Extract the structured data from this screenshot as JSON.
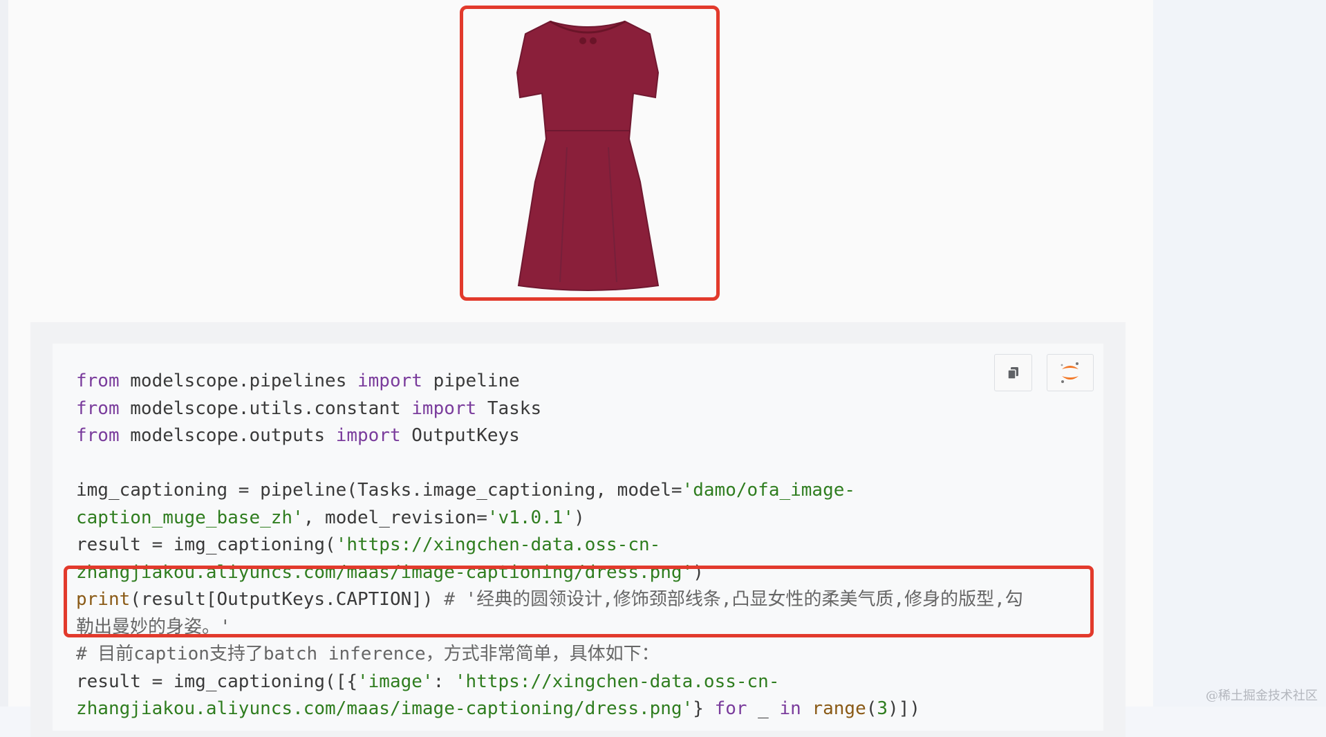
{
  "product_image": {
    "icon": "red-dress-image"
  },
  "toolbar": {
    "copy_icon": "copy-icon",
    "jupyter_icon": "jupyter-icon"
  },
  "code": {
    "lines": [
      [
        {
          "c": "kw",
          "t": "from"
        },
        {
          "c": "",
          "t": " modelscope.pipelines "
        },
        {
          "c": "kw",
          "t": "import"
        },
        {
          "c": "",
          "t": " pipeline"
        }
      ],
      [
        {
          "c": "kw",
          "t": "from"
        },
        {
          "c": "",
          "t": " modelscope.utils.constant "
        },
        {
          "c": "kw",
          "t": "import"
        },
        {
          "c": "",
          "t": " Tasks"
        }
      ],
      [
        {
          "c": "kw",
          "t": "from"
        },
        {
          "c": "",
          "t": " modelscope.outputs "
        },
        {
          "c": "kw",
          "t": "import"
        },
        {
          "c": "",
          "t": " OutputKeys"
        }
      ],
      [],
      [
        {
          "c": "",
          "t": "img_captioning = pipeline(Tasks.image_captioning, model="
        },
        {
          "c": "str",
          "t": "'damo/ofa_image-"
        }
      ],
      [
        {
          "c": "str",
          "t": "caption_muge_base_zh'"
        },
        {
          "c": "",
          "t": ", model_revision="
        },
        {
          "c": "str",
          "t": "'v1.0.1'"
        },
        {
          "c": "",
          "t": ")"
        }
      ],
      [
        {
          "c": "",
          "t": "result = img_captioning("
        },
        {
          "c": "str",
          "t": "'https://xingchen-data.oss-cn-"
        }
      ],
      [
        {
          "c": "str",
          "t": "zhangjiakou.aliyuncs.com/maas/image-captioning/dress.png'"
        },
        {
          "c": "",
          "t": ")"
        }
      ],
      [
        {
          "c": "fn",
          "t": "print"
        },
        {
          "c": "",
          "t": "(result[OutputKeys.CAPTION]) "
        },
        {
          "c": "cm",
          "t": "# '经典的圆领设计,修饰颈部线条,凸显女性的柔美气质,修身的版型,勾"
        }
      ],
      [
        {
          "c": "cm",
          "t": "勒出曼妙的身姿。'"
        }
      ],
      [
        {
          "c": "cm",
          "t": "# 目前caption支持了batch inference，方式非常简单，具体如下："
        }
      ],
      [
        {
          "c": "",
          "t": "result = img_captioning([{"
        },
        {
          "c": "str",
          "t": "'image'"
        },
        {
          "c": "",
          "t": ": "
        },
        {
          "c": "str",
          "t": "'https://xingchen-data.oss-cn-"
        }
      ],
      [
        {
          "c": "str",
          "t": "zhangjiakou.aliyuncs.com/maas/image-captioning/dress.png'"
        },
        {
          "c": "",
          "t": "} "
        },
        {
          "c": "kw",
          "t": "for"
        },
        {
          "c": "",
          "t": " _ "
        },
        {
          "c": "kw",
          "t": "in"
        },
        {
          "c": "",
          "t": " "
        },
        {
          "c": "fn",
          "t": "range"
        },
        {
          "c": "",
          "t": "("
        },
        {
          "c": "str",
          "t": "3"
        },
        {
          "c": "",
          "t": ")])"
        }
      ]
    ]
  },
  "watermark": "@稀土掘金技术社区"
}
